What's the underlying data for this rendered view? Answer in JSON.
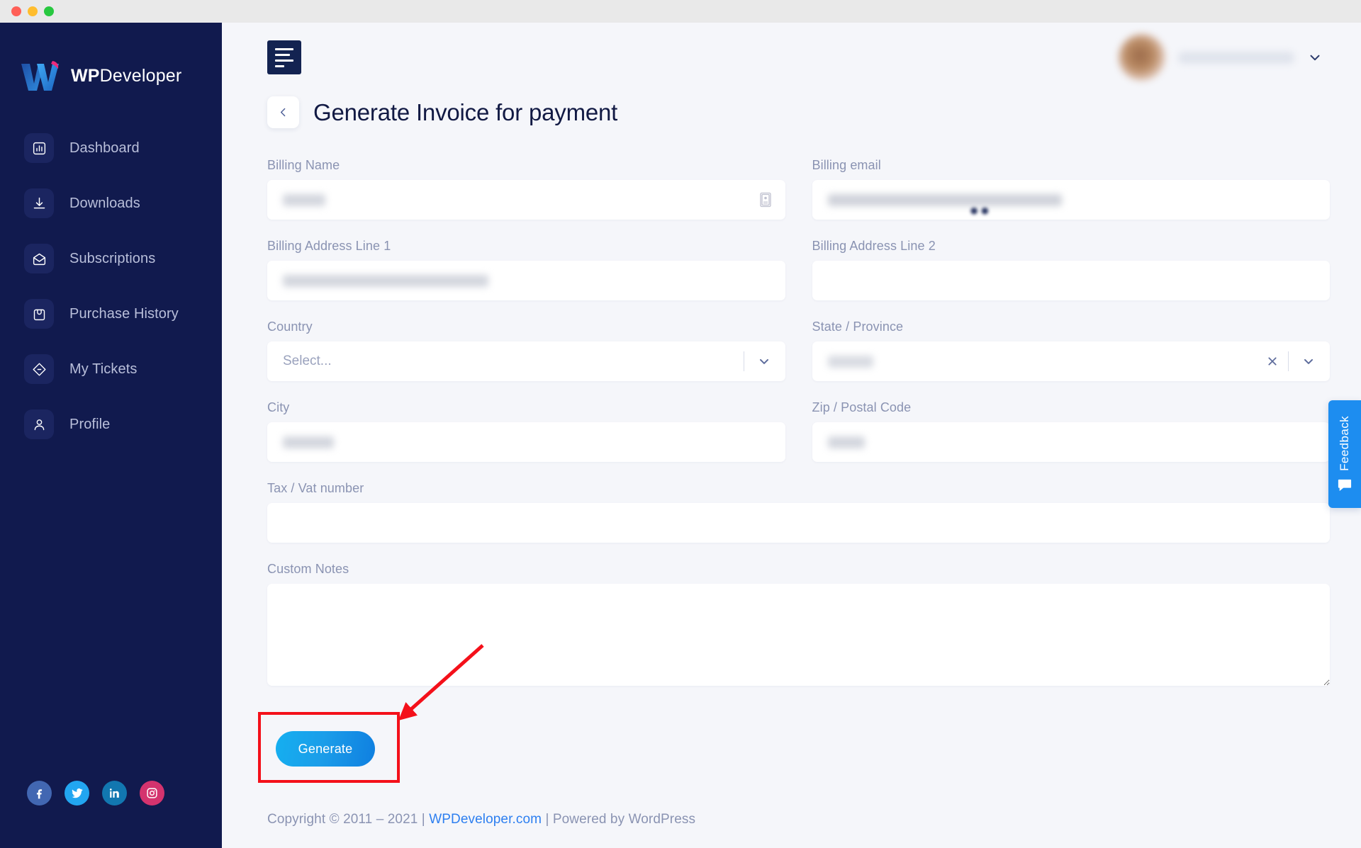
{
  "window": {
    "traffic_lights": [
      "close",
      "minimize",
      "zoom"
    ]
  },
  "sidebar": {
    "brand": {
      "bold": "WP",
      "regular": "Developer",
      "logo_icon": "wpdeveloper-logo-icon"
    },
    "items": [
      {
        "label": "Dashboard",
        "icon": "chart-bar-icon"
      },
      {
        "label": "Downloads",
        "icon": "download-icon"
      },
      {
        "label": "Subscriptions",
        "icon": "envelope-open-icon"
      },
      {
        "label": "Purchase History",
        "icon": "shopping-bag-icon"
      },
      {
        "label": "My Tickets",
        "icon": "ticket-icon"
      },
      {
        "label": "Profile",
        "icon": "user-icon"
      }
    ],
    "social": [
      {
        "name": "facebook",
        "icon": "facebook-icon",
        "color": "#4267b2"
      },
      {
        "name": "twitter",
        "icon": "twitter-icon",
        "color": "#22a6f1"
      },
      {
        "name": "linkedin",
        "icon": "linkedin-icon",
        "color": "#1277b0"
      },
      {
        "name": "instagram",
        "icon": "instagram-icon",
        "color": "#d4336e"
      }
    ]
  },
  "topbar": {
    "menu_toggle_icon": "hamburger-icon",
    "user": {
      "name": "",
      "avatar_icon": "user-avatar",
      "caret_icon": "chevron-down-icon"
    }
  },
  "page": {
    "back_icon": "chevron-left-icon",
    "title": "Generate Invoice for payment"
  },
  "form": {
    "billing_name": {
      "label": "Billing Name",
      "value": "",
      "placeholder": "",
      "trailing_icon": "id-card-icon"
    },
    "billing_email": {
      "label": "Billing email",
      "value": "",
      "placeholder": ""
    },
    "address_line_1": {
      "label": "Billing Address Line 1",
      "value": "",
      "placeholder": ""
    },
    "address_line_2": {
      "label": "Billing Address Line 2",
      "value": "",
      "placeholder": ""
    },
    "country": {
      "label": "Country",
      "value": "",
      "placeholder": "Select...",
      "chevron_icon": "chevron-down-icon"
    },
    "state": {
      "label": "State / Province",
      "value": "",
      "placeholder": "",
      "clear_icon": "close-icon",
      "chevron_icon": "chevron-down-icon"
    },
    "city": {
      "label": "City",
      "value": "",
      "placeholder": ""
    },
    "zip": {
      "label": "Zip / Postal Code",
      "value": "",
      "placeholder": ""
    },
    "tax_vat": {
      "label": "Tax / Vat number",
      "value": "",
      "placeholder": ""
    },
    "custom_notes": {
      "label": "Custom Notes",
      "value": "",
      "placeholder": ""
    },
    "submit": {
      "label": "Generate",
      "accent": "#15aff0"
    }
  },
  "annotation": {
    "highlight_color": "#f4101a",
    "target": "generate-button"
  },
  "feedback": {
    "label": "Feedback",
    "icon": "speech-bubble-icon",
    "color": "#1d8df0"
  },
  "footer": {
    "prefix": "Copyright © 2011 – 2021 | ",
    "link": "WPDeveloper.com",
    "suffix": " | Powered by WordPress"
  }
}
